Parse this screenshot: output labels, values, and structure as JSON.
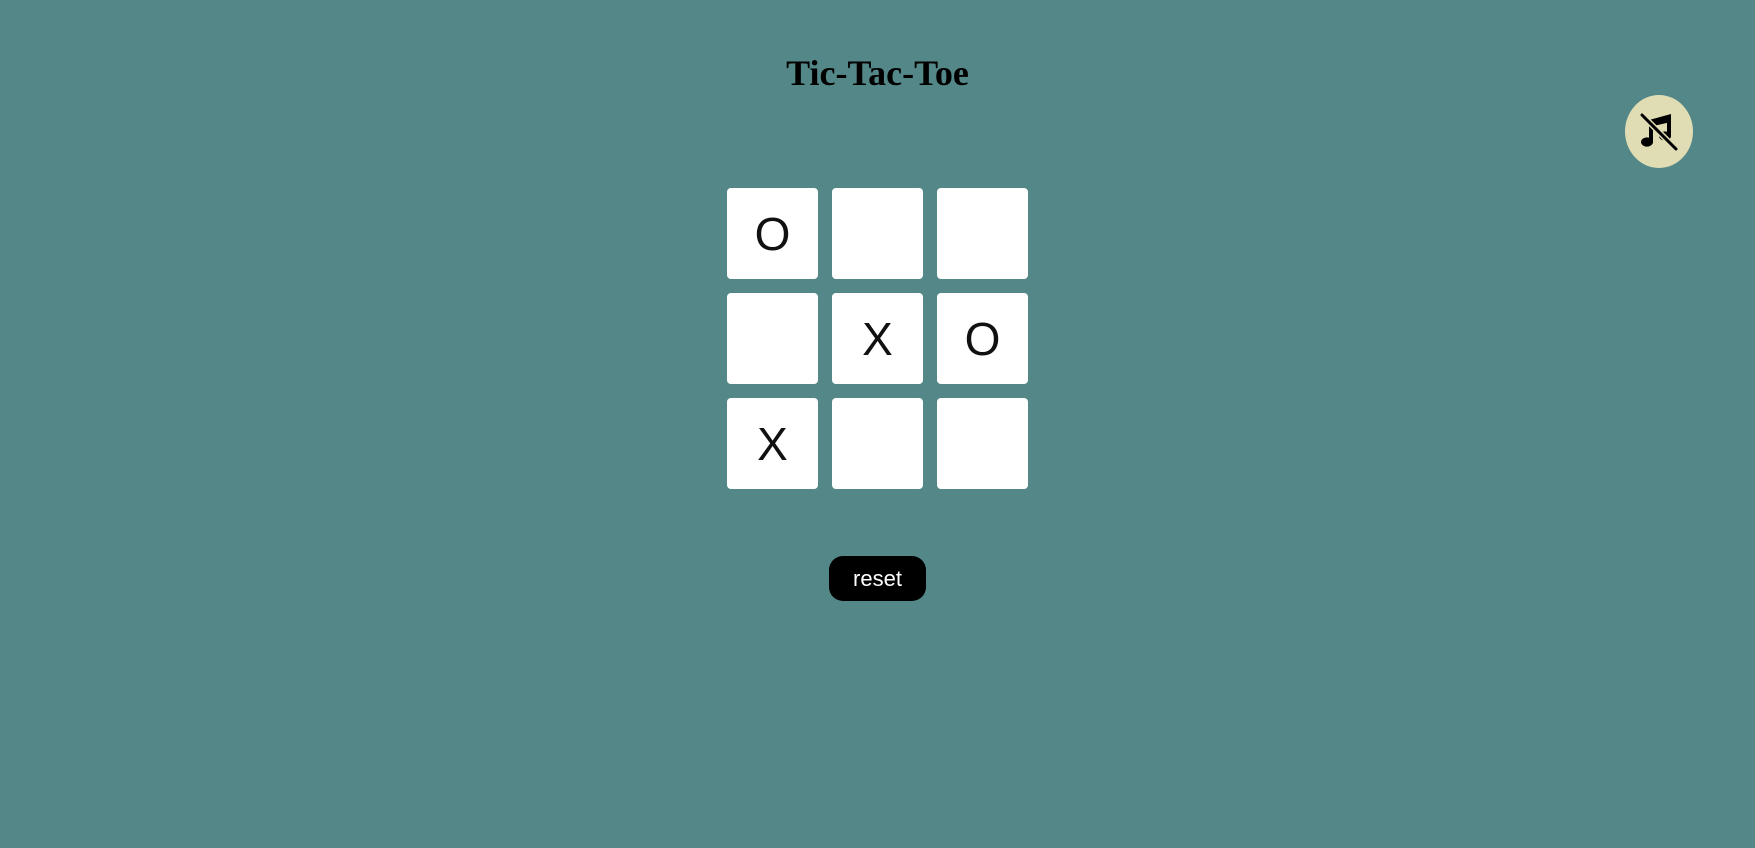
{
  "title": "Tic-Tac-Toe",
  "music_toggle": {
    "icon": "music-off-icon",
    "bg_color": "#e0dcb4"
  },
  "board": {
    "cells": [
      "O",
      "",
      "",
      "",
      "X",
      "O",
      "X",
      "",
      ""
    ]
  },
  "reset_label": "reset",
  "colors": {
    "background": "#548787",
    "cell": "#ffffff",
    "button": "#000000"
  }
}
